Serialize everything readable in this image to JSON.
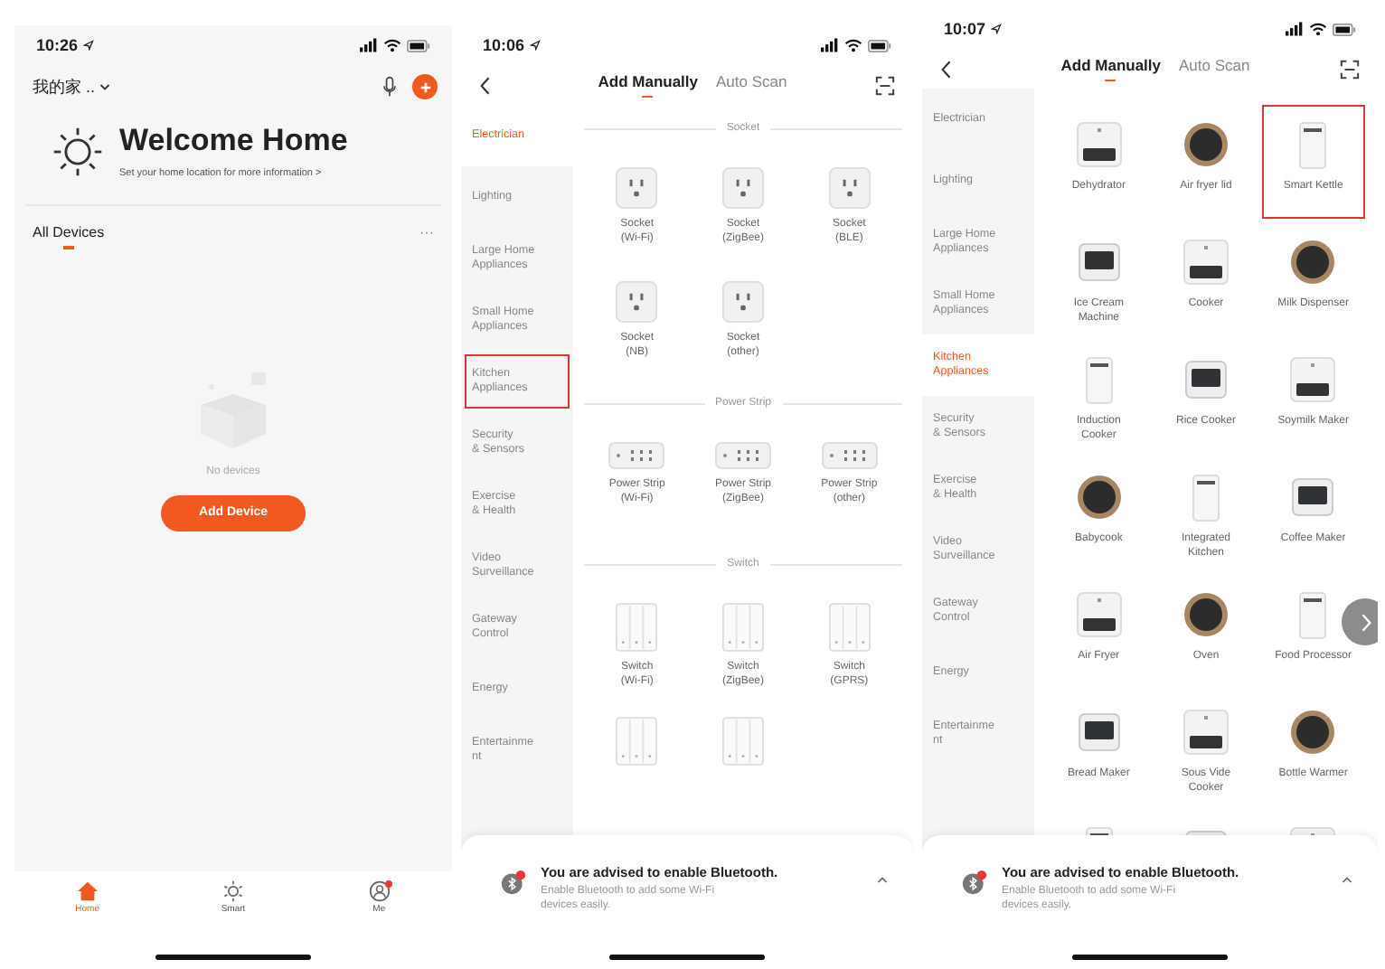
{
  "home_screen": {
    "time": "10:26",
    "home_name": "我的家 ..",
    "welcome_title": "Welcome Home",
    "welcome_subtitle": "Set your home location for more information >",
    "section_label": "All Devices",
    "more": "···",
    "empty_message": "No devices",
    "add_button": "Add Device",
    "tabs": [
      {
        "label": "Home",
        "selected": true,
        "badge": false
      },
      {
        "label": "Smart",
        "selected": false,
        "badge": false
      },
      {
        "label": "Me",
        "selected": false,
        "badge": true
      }
    ]
  },
  "add_screens": [
    {
      "time": "10:06",
      "tabs": [
        {
          "label": "Add Manually",
          "selected": true
        },
        {
          "label": "Auto Scan",
          "selected": false
        }
      ],
      "categories": [
        {
          "label": "Electrician",
          "selected": true,
          "highlighted": false
        },
        {
          "label": "Lighting",
          "selected": false,
          "highlighted": false
        },
        {
          "label": "Large Home\nAppliances",
          "selected": false,
          "highlighted": false
        },
        {
          "label": "Small Home\nAppliances",
          "selected": false,
          "highlighted": false
        },
        {
          "label": "Kitchen\nAppliances",
          "selected": false,
          "highlighted": true
        },
        {
          "label": "Security\n& Sensors",
          "selected": false,
          "highlighted": false
        },
        {
          "label": "Exercise\n& Health",
          "selected": false,
          "highlighted": false
        },
        {
          "label": "Video\nSurveillance",
          "selected": false,
          "highlighted": false
        },
        {
          "label": "Gateway\nControl",
          "selected": false,
          "highlighted": false
        },
        {
          "label": "Energy",
          "selected": false,
          "highlighted": false
        },
        {
          "label": "Entertainme\nnt",
          "selected": false,
          "highlighted": false
        }
      ],
      "sections": [
        {
          "title": "Socket",
          "items": [
            {
              "kind": "socket",
              "label": "Socket\n(Wi-Fi)",
              "highlighted": false
            },
            {
              "kind": "socket",
              "label": "Socket\n(ZigBee)",
              "highlighted": false
            },
            {
              "kind": "socket",
              "label": "Socket\n(BLE)",
              "highlighted": false
            },
            {
              "kind": "socket",
              "label": "Socket\n(NB)",
              "highlighted": false
            },
            {
              "kind": "socket",
              "label": "Socket\n(other)",
              "highlighted": false
            }
          ]
        },
        {
          "title": "Power Strip",
          "items": [
            {
              "kind": "strip",
              "label": "Power Strip\n(Wi-Fi)",
              "highlighted": false
            },
            {
              "kind": "strip",
              "label": "Power Strip\n(ZigBee)",
              "highlighted": false
            },
            {
              "kind": "strip",
              "label": "Power Strip\n(other)",
              "highlighted": false
            }
          ]
        },
        {
          "title": "Switch",
          "items": [
            {
              "kind": "switch",
              "label": "Switch\n(Wi-Fi)",
              "highlighted": false
            },
            {
              "kind": "switch",
              "label": "Switch\n(ZigBee)",
              "highlighted": false
            },
            {
              "kind": "switch",
              "label": "Switch\n(GPRS)",
              "highlighted": false
            },
            {
              "kind": "switch",
              "highlighted": false
            },
            {
              "kind": "switch",
              "highlighted": false
            }
          ]
        }
      ],
      "banner": {
        "title": "You are advised to enable Bluetooth.",
        "text": "Enable Bluetooth to add some Wi-Fi\ndevices easily."
      }
    },
    {
      "time": "10:07",
      "tabs": [
        {
          "label": "Add Manually",
          "selected": true
        },
        {
          "label": "Auto Scan",
          "selected": false
        }
      ],
      "categories": [
        {
          "label": "Electrician",
          "selected": false,
          "highlighted": false
        },
        {
          "label": "Lighting",
          "selected": false,
          "highlighted": false
        },
        {
          "label": "Large Home\nAppliances",
          "selected": false,
          "highlighted": false
        },
        {
          "label": "Small Home\nAppliances",
          "selected": false,
          "highlighted": false
        },
        {
          "label": "Kitchen\nAppliances",
          "selected": true,
          "highlighted": false
        },
        {
          "label": "Security\n& Sensors",
          "selected": false,
          "highlighted": false
        },
        {
          "label": "Exercise\n& Health",
          "selected": false,
          "highlighted": false
        },
        {
          "label": "Video\nSurveillance",
          "selected": false,
          "highlighted": false
        },
        {
          "label": "Gateway\nControl",
          "selected": false,
          "highlighted": false
        },
        {
          "label": "Energy",
          "selected": false,
          "highlighted": false
        },
        {
          "label": "Entertainme\nnt",
          "selected": false,
          "highlighted": false
        }
      ],
      "sections": [
        {
          "items": [
            {
              "kind": "appliance",
              "label": "Dehydrator",
              "highlighted": false
            },
            {
              "kind": "appliance",
              "label": "Air fryer lid",
              "highlighted": false
            },
            {
              "kind": "appliance",
              "label": "Smart Kettle",
              "highlighted": true
            },
            {
              "kind": "appliance",
              "label": "Ice Cream\nMachine",
              "highlighted": false
            },
            {
              "kind": "appliance",
              "label": "Cooker",
              "highlighted": false
            },
            {
              "kind": "appliance",
              "label": "Milk Dispenser",
              "highlighted": false
            },
            {
              "kind": "appliance",
              "label": "Induction\nCooker",
              "highlighted": false
            },
            {
              "kind": "appliance",
              "label": "Rice Cooker",
              "highlighted": false
            },
            {
              "kind": "appliance",
              "label": "Soymilk Maker",
              "highlighted": false
            },
            {
              "kind": "appliance",
              "label": "Babycook",
              "highlighted": false
            },
            {
              "kind": "appliance",
              "label": "Integrated\nKitchen",
              "highlighted": false
            },
            {
              "kind": "appliance",
              "label": "Coffee Maker",
              "highlighted": false
            },
            {
              "kind": "appliance",
              "label": "Air Fryer",
              "highlighted": false
            },
            {
              "kind": "appliance",
              "label": "Oven",
              "highlighted": false
            },
            {
              "kind": "appliance",
              "label": "Food Processor",
              "highlighted": false
            },
            {
              "kind": "appliance",
              "label": "Bread Maker",
              "highlighted": false
            },
            {
              "kind": "appliance",
              "label": "Sous Vide\nCooker",
              "highlighted": false
            },
            {
              "kind": "appliance",
              "label": "Bottle Warmer",
              "highlighted": false
            },
            {
              "kind": "appliance",
              "highlighted": false
            },
            {
              "kind": "appliance",
              "highlighted": false
            },
            {
              "kind": "appliance",
              "highlighted": false
            }
          ]
        }
      ],
      "next_button": true,
      "banner": {
        "title": "You are advised to enable Bluetooth.",
        "text": "Enable Bluetooth to add some Wi-Fi\ndevices easily."
      }
    }
  ]
}
